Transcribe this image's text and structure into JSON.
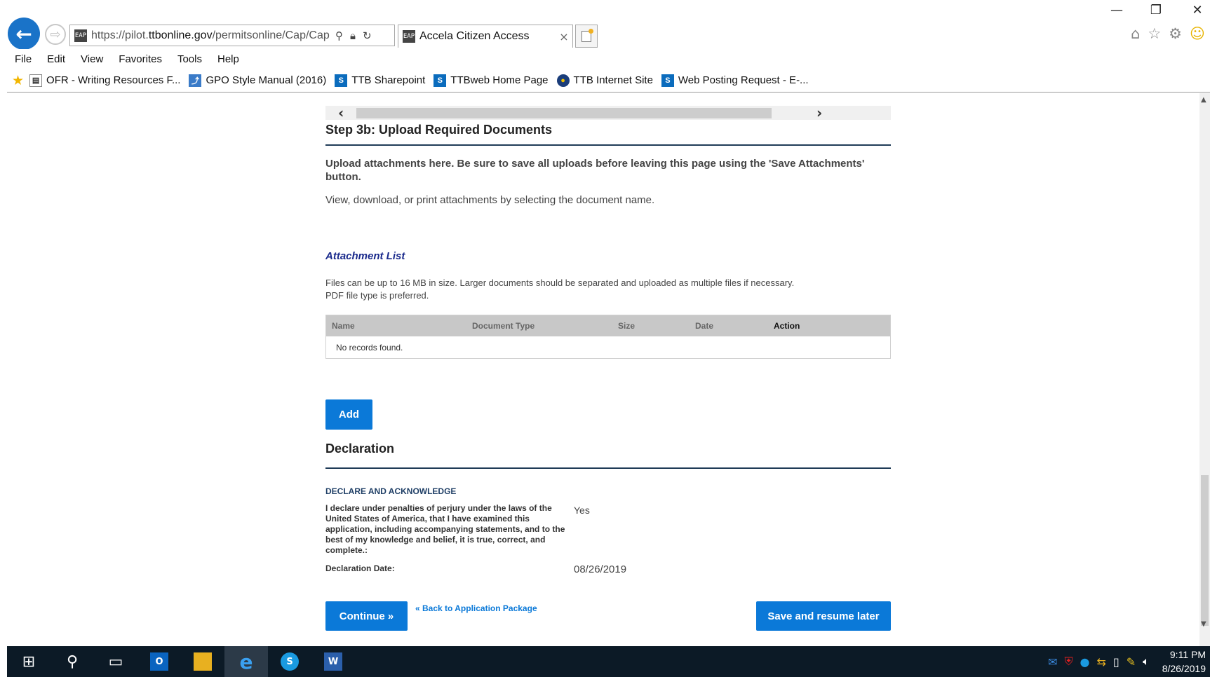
{
  "browser": {
    "url_prefix": "https://pilot.",
    "url_domain": "ttbonline.gov",
    "url_rest": "/permitsonline/Cap/Cap",
    "favicon_text": "EAP",
    "tab_title": "Accela Citizen Access",
    "tab_close": "×",
    "menu": [
      "File",
      "Edit",
      "View",
      "Favorites",
      "Tools",
      "Help"
    ],
    "favorites": [
      {
        "label": "OFR - Writing Resources F...",
        "icon": "page-icon"
      },
      {
        "label": "GPO Style Manual (2016)",
        "icon": "gpo-icon"
      },
      {
        "label": "TTB Sharepoint",
        "icon": "sharepoint-icon"
      },
      {
        "label": "TTBweb Home Page",
        "icon": "sharepoint-icon"
      },
      {
        "label": "TTB Internet Site",
        "icon": "ttb-seal-icon"
      },
      {
        "label": "Web Posting Request - E-...",
        "icon": "sharepoint-icon"
      }
    ]
  },
  "page": {
    "step_title": "Step 3b: Upload Required Documents",
    "instructions_1": "Upload attachments here. Be sure to save all uploads before leaving this page using the 'Save Attachments' button.",
    "instructions_2": "View, download, or print attachments by selecting the document name.",
    "attachment_heading": "Attachment List",
    "files_note_1": "Files can be up to 16 MB in size. Larger documents should be separated and uploaded as multiple files if necessary.",
    "files_note_2": "PDF file type is preferred.",
    "table": {
      "columns": [
        "Name",
        "Document Type",
        "Size",
        "Date",
        "Action"
      ],
      "empty_message": "No records found."
    },
    "add_label": "Add",
    "declaration_title": "Declaration",
    "declare_subheading": "DECLARE AND ACKNOWLEDGE",
    "declare_text": "I declare under penalties of perjury under the laws of the United States of America, that I have examined this application, including accompanying statements, and to the best of my knowledge and belief, it is true, correct, and complete.:",
    "declare_value": "Yes",
    "date_label": "Declaration Date:",
    "date_value": "08/26/2019",
    "continue_label": "Continue »",
    "back_link": "« Back to Application Package",
    "save_later_label": "Save and resume later"
  },
  "taskbar": {
    "time": "9:11 PM",
    "date": "8/26/2019"
  }
}
